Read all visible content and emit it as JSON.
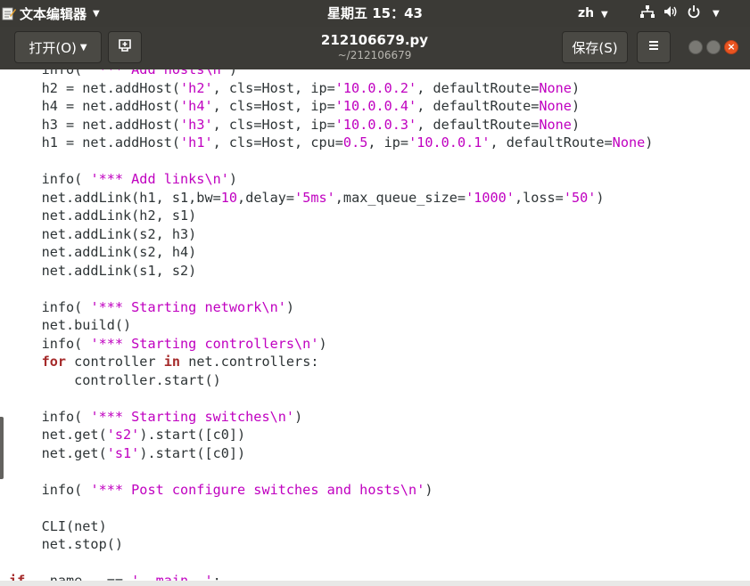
{
  "system_bar": {
    "app_name": "文本编辑器",
    "clock": "星期五 15：43",
    "input_method": "zh"
  },
  "header": {
    "open_label": "打开(O)",
    "save_label": "保存(S)",
    "file_name": "212106679.py",
    "file_path": "~/212106679"
  },
  "editor": {
    "lines": [
      [
        [
          "",
          "    info( "
        ],
        [
          "str",
          "'*** Add hosts"
        ],
        [
          "esc",
          "\\n"
        ],
        [
          "str",
          "'"
        ],
        [
          "",
          ")"
        ]
      ],
      [
        [
          "",
          "    h2 = net.addHost("
        ],
        [
          "str",
          "'h2'"
        ],
        [
          "",
          ", cls=Host, ip="
        ],
        [
          "str",
          "'10.0.0.2'"
        ],
        [
          "",
          ", defaultRoute="
        ],
        [
          "const",
          "None"
        ],
        [
          "",
          ")"
        ]
      ],
      [
        [
          "",
          "    h4 = net.addHost("
        ],
        [
          "str",
          "'h4'"
        ],
        [
          "",
          ", cls=Host, ip="
        ],
        [
          "str",
          "'10.0.0.4'"
        ],
        [
          "",
          ", defaultRoute="
        ],
        [
          "const",
          "None"
        ],
        [
          "",
          ")"
        ]
      ],
      [
        [
          "",
          "    h3 = net.addHost("
        ],
        [
          "str",
          "'h3'"
        ],
        [
          "",
          ", cls=Host, ip="
        ],
        [
          "str",
          "'10.0.0.3'"
        ],
        [
          "",
          ", defaultRoute="
        ],
        [
          "const",
          "None"
        ],
        [
          "",
          ")"
        ]
      ],
      [
        [
          "",
          "    h1 = net.addHost("
        ],
        [
          "str",
          "'h1'"
        ],
        [
          "",
          ", cls=Host, cpu="
        ],
        [
          "num",
          "0.5"
        ],
        [
          "",
          ", ip="
        ],
        [
          "str",
          "'10.0.0.1'"
        ],
        [
          "",
          ", defaultRoute="
        ],
        [
          "const",
          "None"
        ],
        [
          "",
          ")"
        ]
      ],
      [
        [
          "",
          ""
        ]
      ],
      [
        [
          "",
          "    info( "
        ],
        [
          "str",
          "'*** Add links"
        ],
        [
          "esc",
          "\\n"
        ],
        [
          "str",
          "'"
        ],
        [
          "",
          ")"
        ]
      ],
      [
        [
          "",
          "    net.addLink(h1, s1,bw="
        ],
        [
          "num",
          "10"
        ],
        [
          "",
          ",delay="
        ],
        [
          "str",
          "'5ms'"
        ],
        [
          "",
          ",max_queue_size="
        ],
        [
          "str",
          "'1000'"
        ],
        [
          "",
          ",loss="
        ],
        [
          "str",
          "'50'"
        ],
        [
          "",
          ")"
        ]
      ],
      [
        [
          "",
          "    net.addLink(h2, s1)"
        ]
      ],
      [
        [
          "",
          "    net.addLink(s2, h3)"
        ]
      ],
      [
        [
          "",
          "    net.addLink(s2, h4)"
        ]
      ],
      [
        [
          "",
          "    net.addLink(s1, s2)"
        ]
      ],
      [
        [
          "",
          ""
        ]
      ],
      [
        [
          "",
          "    info( "
        ],
        [
          "str",
          "'*** Starting network"
        ],
        [
          "esc",
          "\\n"
        ],
        [
          "str",
          "'"
        ],
        [
          "",
          ")"
        ]
      ],
      [
        [
          "",
          "    net.build()"
        ]
      ],
      [
        [
          "",
          "    info( "
        ],
        [
          "str",
          "'*** Starting controllers"
        ],
        [
          "esc",
          "\\n"
        ],
        [
          "str",
          "'"
        ],
        [
          "",
          ")"
        ]
      ],
      [
        [
          "",
          "    "
        ],
        [
          "kw",
          "for"
        ],
        [
          "",
          " controller "
        ],
        [
          "kw",
          "in"
        ],
        [
          "",
          " net.controllers:"
        ]
      ],
      [
        [
          "",
          "        controller.start()"
        ]
      ],
      [
        [
          "",
          ""
        ]
      ],
      [
        [
          "",
          "    info( "
        ],
        [
          "str",
          "'*** Starting switches"
        ],
        [
          "esc",
          "\\n"
        ],
        [
          "str",
          "'"
        ],
        [
          "",
          ")"
        ]
      ],
      [
        [
          "",
          "    net.get("
        ],
        [
          "str",
          "'s2'"
        ],
        [
          "",
          ").start([c0])"
        ]
      ],
      [
        [
          "",
          "    net.get("
        ],
        [
          "str",
          "'s1'"
        ],
        [
          "",
          ").start([c0])"
        ]
      ],
      [
        [
          "",
          ""
        ]
      ],
      [
        [
          "",
          "    info( "
        ],
        [
          "str",
          "'*** Post configure switches and hosts"
        ],
        [
          "esc",
          "\\n"
        ],
        [
          "str",
          "'"
        ],
        [
          "",
          ")"
        ]
      ],
      [
        [
          "",
          ""
        ]
      ],
      [
        [
          "",
          "    CLI(net)"
        ]
      ],
      [
        [
          "",
          "    net.stop()"
        ]
      ],
      [
        [
          "",
          ""
        ]
      ],
      [
        [
          "kw",
          "if"
        ],
        [
          "",
          " __name__ == "
        ],
        [
          "str",
          "'__main__'"
        ],
        [
          "",
          ":"
        ]
      ]
    ]
  },
  "colors": {
    "string": "#c000c0",
    "keyword": "#a52a2a",
    "header_bg": "#3c3b37",
    "close_button": "#e95420"
  }
}
